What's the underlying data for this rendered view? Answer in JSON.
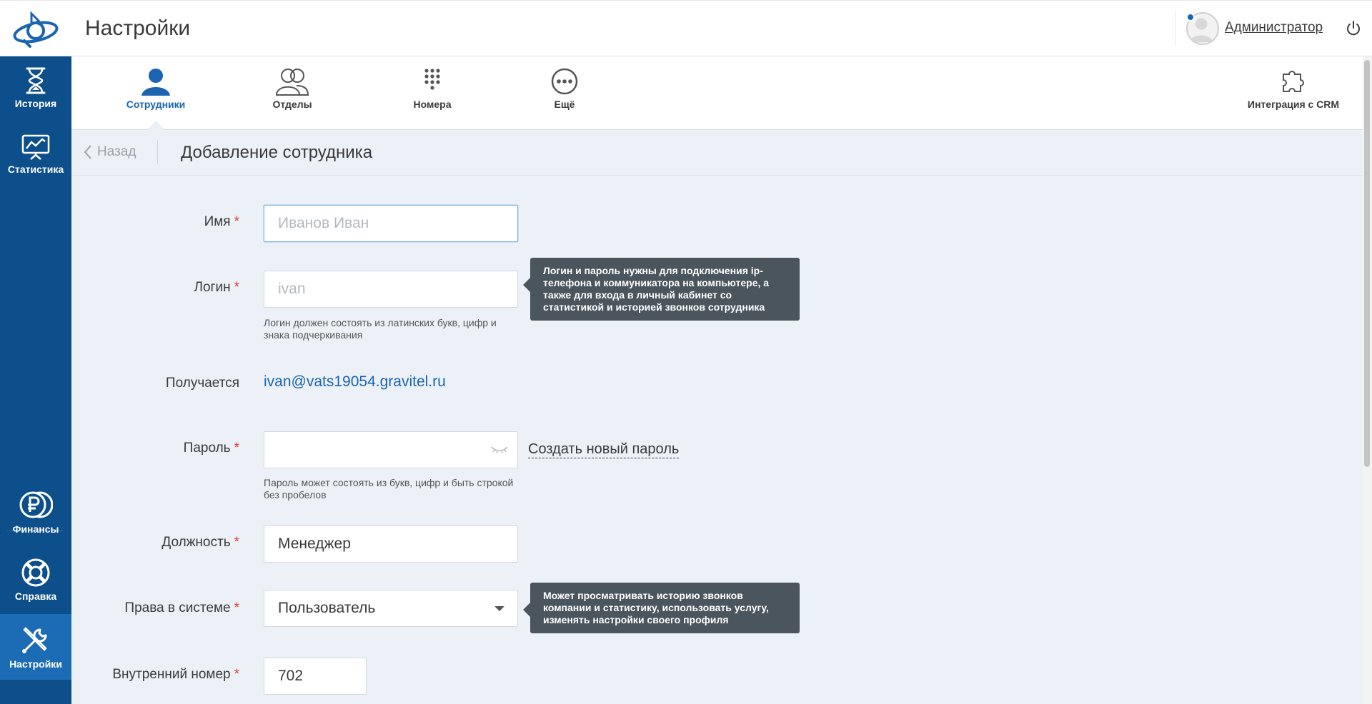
{
  "header": {
    "title": "Настройки",
    "user_name": "Администратор"
  },
  "sidebar": {
    "items": [
      {
        "label": "История",
        "icon": "hourglass-icon"
      },
      {
        "label": "Статистика",
        "icon": "chart-board-icon"
      },
      {
        "label": "Финансы",
        "icon": "ruble-coins-icon"
      },
      {
        "label": "Справка",
        "icon": "lifebuoy-icon"
      },
      {
        "label": "Настройки",
        "icon": "tools-icon",
        "active": true
      }
    ]
  },
  "tabs": [
    {
      "label": "Сотрудники",
      "icon": "person-icon",
      "active": true
    },
    {
      "label": "Отделы",
      "icon": "group-icon"
    },
    {
      "label": "Номера",
      "icon": "keypad-icon"
    },
    {
      "label": "Ещё",
      "icon": "more-icon"
    },
    {
      "label": "Интеграция с CRM",
      "icon": "puzzle-icon"
    }
  ],
  "subheader": {
    "back_label": "Назад",
    "title": "Добавление сотрудника"
  },
  "form": {
    "name": {
      "label": "Имя",
      "placeholder": "Иванов Иван",
      "value": ""
    },
    "login": {
      "label": "Логин",
      "placeholder": "ivan",
      "value": "",
      "hint": "Логин должен состоять из латинских букв, цифр и знака подчеркивания",
      "tooltip": "Логин и пароль нужны для подключения ip-телефона и коммуникатора на компьютере, а также для входа в личный кабинет со статистикой и историей звонков сотрудника"
    },
    "result": {
      "label": "Получается",
      "value": "ivan@vats19054.gravitel.ru"
    },
    "password": {
      "label": "Пароль",
      "value": "",
      "generate_link": "Создать новый пароль",
      "hint": "Пароль может состоять из букв, цифр и быть строкой без пробелов"
    },
    "position": {
      "label": "Должность",
      "value": "Менеджер"
    },
    "rights": {
      "label": "Права в системе",
      "value": "Пользователь",
      "tooltip": "Может просматривать историю звонков компании и статистику, использовать услугу, изменять настройки своего профиля"
    },
    "extension": {
      "label": "Внутренний номер",
      "value": "702"
    }
  },
  "colors": {
    "sidebar_bg": "#0d4f8b",
    "sidebar_active": "#1c6cb5",
    "accent": "#1a64b0",
    "required": "#e03a3a",
    "tooltip_bg": "#4a555e",
    "page_bg": "#ecf1f7"
  }
}
